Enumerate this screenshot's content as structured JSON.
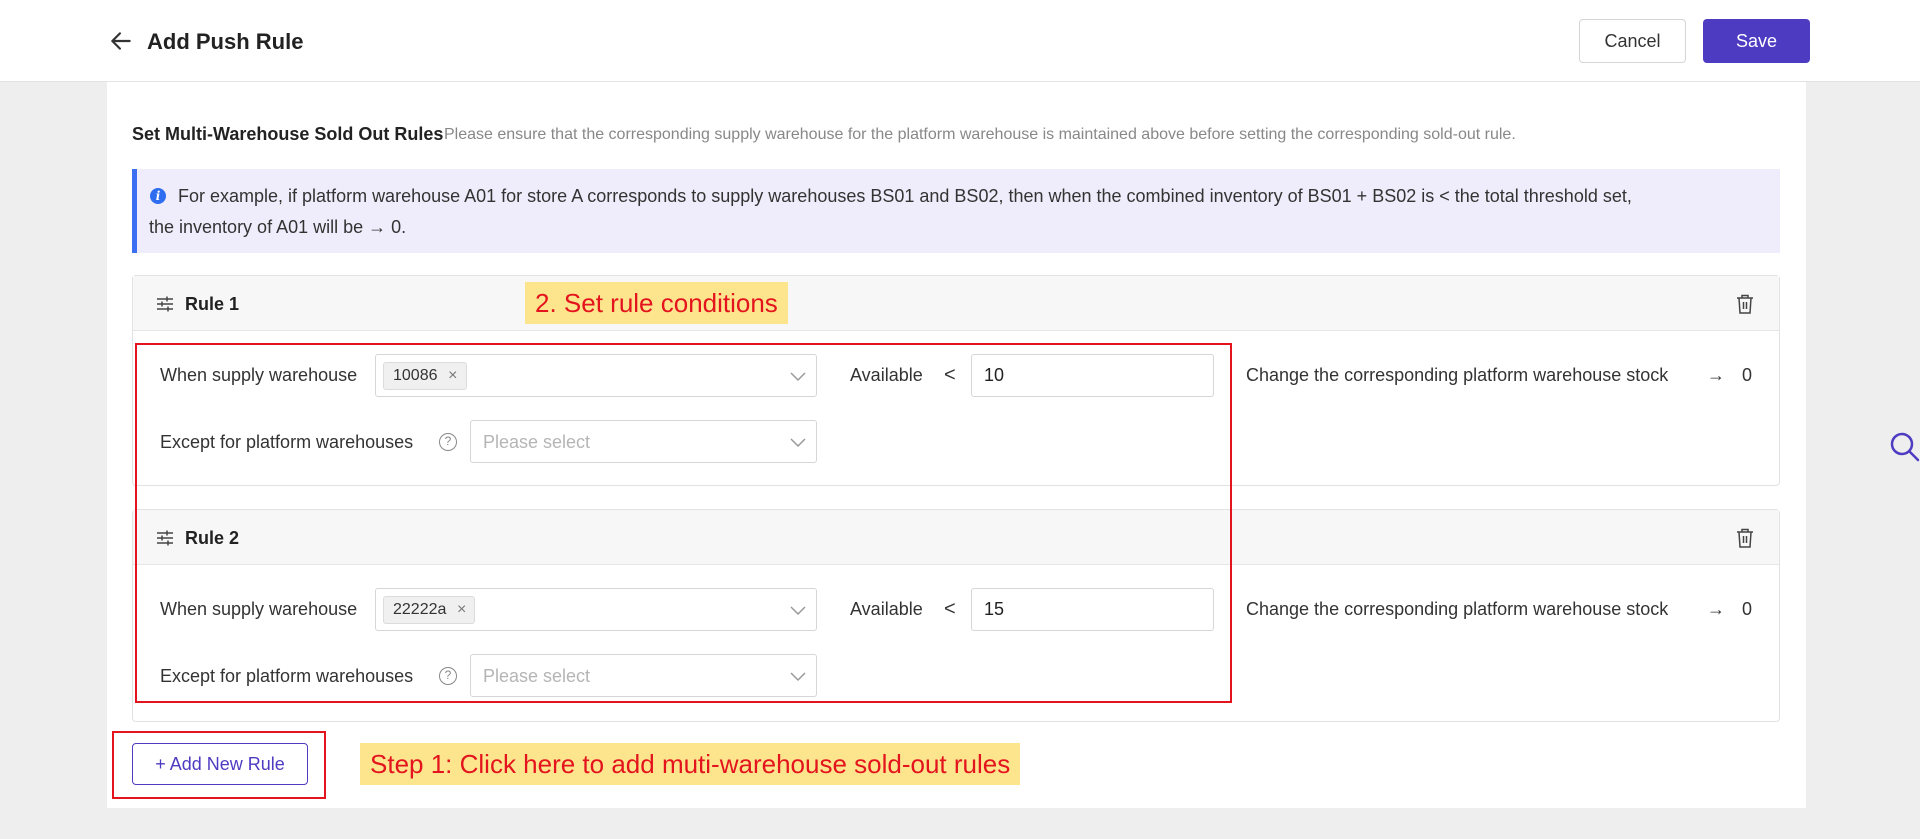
{
  "header": {
    "title": "Add Push Rule",
    "cancel_label": "Cancel",
    "save_label": "Save",
    "back_icon": "arrow-left-icon"
  },
  "section": {
    "title": "Set Multi-Warehouse Sold Out Rules",
    "hint": "Please ensure that the corresponding supply warehouse for the platform warehouse is maintained above before setting the corresponding sold-out rule."
  },
  "info": {
    "icon": "info-icon",
    "line1": "For example, if platform warehouse A01 for store A corresponds to supply warehouses BS01 and BS02, then when the combined inventory of BS01 + BS02 is  <  the total threshold set,",
    "line2": "the inventory of A01 will be  → 0."
  },
  "labels": {
    "when_supply": "When supply warehouse",
    "available": "Available",
    "less_than": "<",
    "change_stock": "Change the corresponding platform warehouse stock",
    "arrow": "→",
    "zero": "0",
    "except": "Except for platform warehouses",
    "help": "?",
    "placeholder": "Please select",
    "tag_close": "×"
  },
  "rules": [
    {
      "title": "Rule 1",
      "supply_tag": "10086",
      "available_value": "10"
    },
    {
      "title": "Rule 2",
      "supply_tag": "22222a",
      "available_value": "15"
    }
  ],
  "add_rule_label": "+ Add New Rule",
  "annotations": {
    "step2": "2. Set rule conditions",
    "step1": "Step 1: Click here to add muti-warehouse sold-out rules"
  },
  "colors": {
    "primary": "#4d3bc2",
    "annotation_red": "#e3141d",
    "annotation_bg": "#fde58d",
    "info_bar": "#3b6ef0",
    "info_bg": "#efedfb"
  }
}
